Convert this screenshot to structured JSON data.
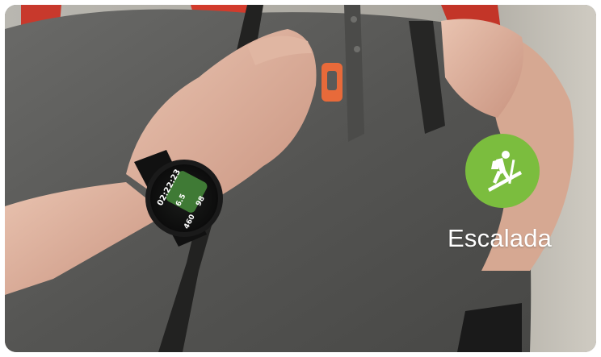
{
  "activity": {
    "label": "Escalada",
    "icon": "hiking-climbing-icon",
    "badge_color": "#7bbd3e"
  },
  "watch": {
    "time_display": "02:22:23",
    "distance": "6.5",
    "calories": "460",
    "heart_rate": "98"
  },
  "colors": {
    "shirt": "#5a5a58",
    "backpack_strap": "#d8392b",
    "buckle": "#e86a3a"
  }
}
